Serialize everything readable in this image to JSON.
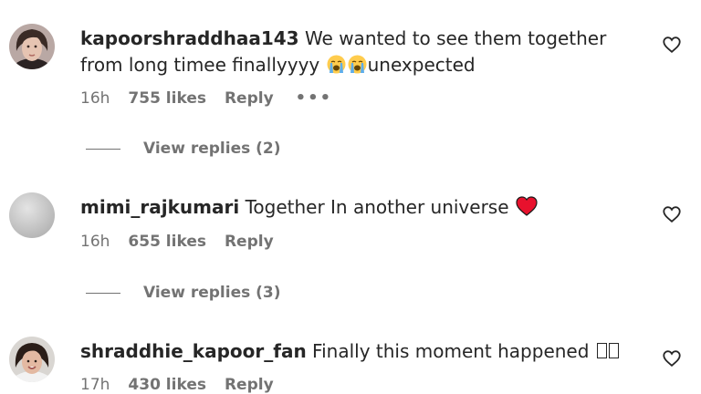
{
  "comments": [
    {
      "username": "kapoorshraddhaa143",
      "text": "We wanted to see them together from long timee finallyyyy",
      "text_tail": "unexpected",
      "time": "16h",
      "likes": "755 likes",
      "reply": "Reply",
      "more": "•••",
      "view_replies": "View replies (2)",
      "emoji": [
        "loudly-crying-face-emoji",
        "loudly-crying-face-emoji"
      ]
    },
    {
      "username": "mimi_rajkumari",
      "text": "Together In another universe",
      "time": "16h",
      "likes": "655 likes",
      "reply": "Reply",
      "view_replies": "View replies (3)",
      "emoji": [
        "red-heart-emoji"
      ]
    },
    {
      "username": "shraddhie_kapoor_fan",
      "text": "Finally this moment happened",
      "time": "17h",
      "likes": "430 likes",
      "reply": "Reply"
    }
  ],
  "colors": {
    "text": "#262626",
    "secondary": "#737373",
    "heart_emoji": "#e8112d",
    "cry_emoji": "#ffcc4d",
    "tears": "#5dadec"
  },
  "icons": [
    "heart-outline-icon"
  ]
}
